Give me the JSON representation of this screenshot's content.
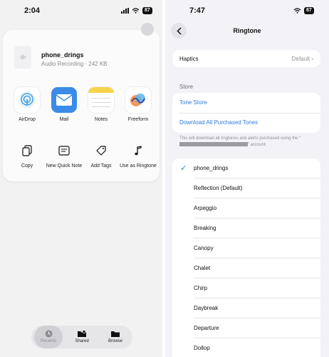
{
  "left": {
    "status": {
      "time": "2:04",
      "battery": "87"
    },
    "file": {
      "name": "phone_drings",
      "meta": "Audio Recording · 242 KB"
    },
    "apps": [
      {
        "label": "AirDrop",
        "icon": "airdrop-icon"
      },
      {
        "label": "Mail",
        "icon": "mail-icon"
      },
      {
        "label": "Notes",
        "icon": "notes-icon"
      },
      {
        "label": "Freeform",
        "icon": "freeform-icon"
      }
    ],
    "actions": [
      {
        "label": "Copy",
        "icon": "copy-icon"
      },
      {
        "label": "New Quick Note",
        "icon": "quick-note-icon"
      },
      {
        "label": "Add Tags",
        "icon": "tag-icon"
      },
      {
        "label": "Use as Ringtone",
        "icon": "music-note-icon"
      }
    ],
    "tabs": [
      {
        "label": "Recents",
        "icon": "clock-icon",
        "active": true
      },
      {
        "label": "Shared",
        "icon": "shared-folder-icon"
      },
      {
        "label": "Browse",
        "icon": "folder-icon"
      }
    ]
  },
  "right": {
    "status": {
      "time": "7:47",
      "battery": "87"
    },
    "nav": {
      "title": "Ringtone"
    },
    "haptics": {
      "label": "Haptics",
      "value": "Default"
    },
    "store": {
      "header": "Store",
      "tone_store": "Tone Store",
      "download_all": "Download All Purchased Tones",
      "note_before": "This will download all ringtones and alerts purchased using the “",
      "note_after": "” account."
    },
    "tones": [
      {
        "label": "phone_drings",
        "selected": true
      },
      {
        "label": "Reflection (Default)"
      },
      {
        "label": "Arpeggio"
      },
      {
        "label": "Breaking"
      },
      {
        "label": "Canopy"
      },
      {
        "label": "Chalet"
      },
      {
        "label": "Chirp"
      },
      {
        "label": "Daybreak"
      },
      {
        "label": "Departure"
      },
      {
        "label": "Dollop"
      }
    ],
    "check_glyph": "✓"
  },
  "colors": {
    "accent": "#2f7bd8",
    "mail": "#3b8be8",
    "notes": "#f7d34a"
  }
}
